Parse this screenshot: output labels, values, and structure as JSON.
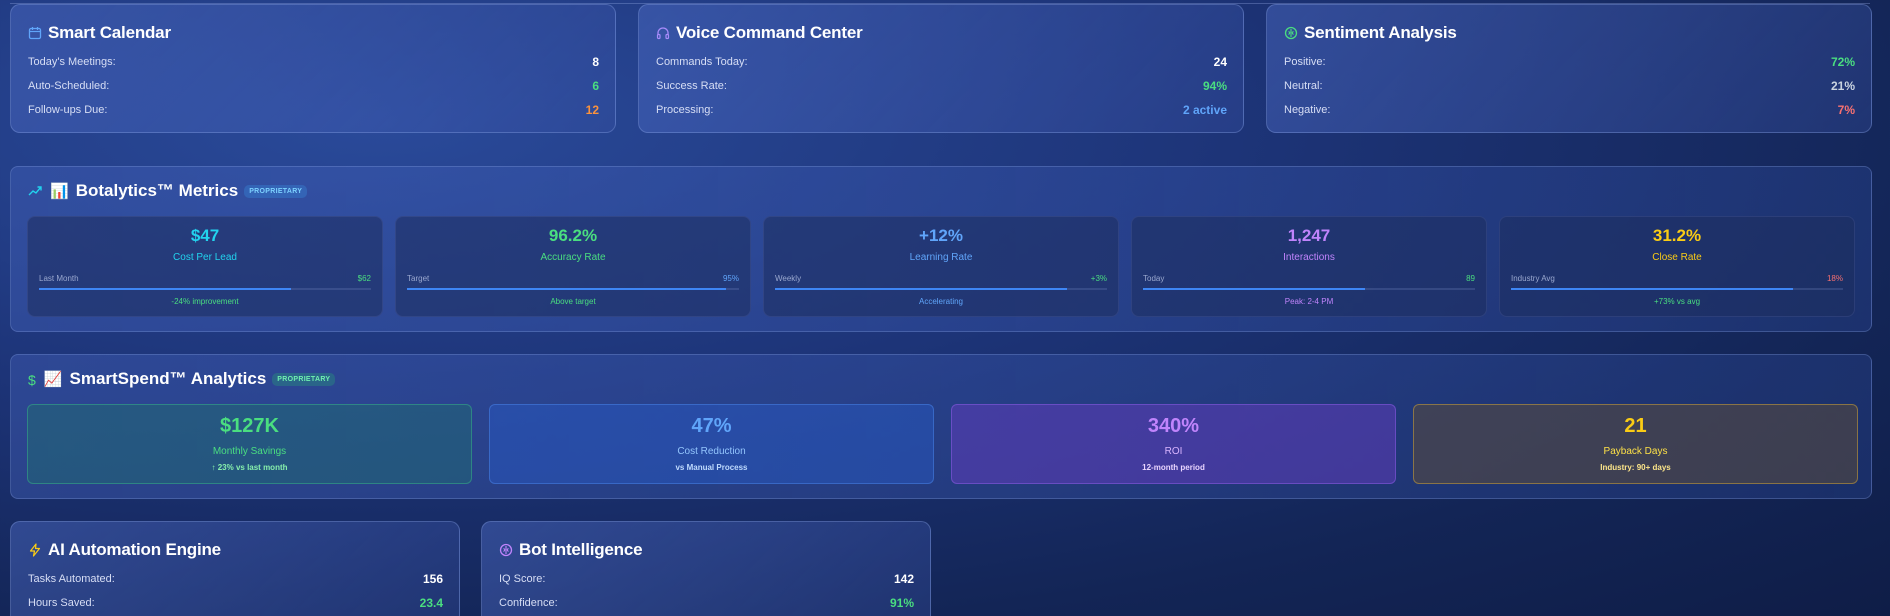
{
  "colors": {
    "green": "#4ade80",
    "orange": "#fb923c",
    "blue": "#60a5fa",
    "red": "#f87171",
    "gray": "#cbd5e1",
    "cyan": "#22d3ee",
    "purple": "#c084fc",
    "yellow": "#facc15",
    "white": "#ffffff"
  },
  "calendar": {
    "title": "Smart Calendar",
    "icon": "calendar-icon",
    "rows": [
      {
        "label": "Today's Meetings:",
        "value": "8"
      },
      {
        "label": "Auto-Scheduled:",
        "value": "6"
      },
      {
        "label": "Follow-ups Due:",
        "value": "12"
      }
    ]
  },
  "voice": {
    "title": "Voice Command Center",
    "icon": "headphones-icon",
    "rows": [
      {
        "label": "Commands Today:",
        "value": "24"
      },
      {
        "label": "Success Rate:",
        "value": "94%"
      },
      {
        "label": "Processing:",
        "value": "2 active"
      }
    ]
  },
  "sentiment": {
    "title": "Sentiment Analysis",
    "icon": "brain-icon",
    "rows": [
      {
        "label": "Positive:",
        "value": "72%"
      },
      {
        "label": "Neutral:",
        "value": "21%"
      },
      {
        "label": "Negative:",
        "value": "7%"
      }
    ]
  },
  "botalytics": {
    "title": "Botalytics™ Metrics",
    "emoji": "📊",
    "icon": "trending-up-icon",
    "badge": "PROPRIETARY",
    "metrics": [
      {
        "value": "$47",
        "name": "Cost Per Lead",
        "sub_label": "Last Month",
        "sub_value": "$62",
        "progress": 0.76,
        "note": "-24% improvement"
      },
      {
        "value": "96.2%",
        "name": "Accuracy Rate",
        "sub_label": "Target",
        "sub_value": "95%",
        "progress": 0.96,
        "note": "Above target"
      },
      {
        "value": "+12%",
        "name": "Learning Rate",
        "sub_label": "Weekly",
        "sub_value": "+3%",
        "progress": 0.88,
        "note": "Accelerating"
      },
      {
        "value": "1,247",
        "name": "Interactions",
        "sub_label": "Today",
        "sub_value": "89",
        "progress": 0.67,
        "note": "Peak: 2-4 PM"
      },
      {
        "value": "31.2%",
        "name": "Close Rate",
        "sub_label": "Industry Avg",
        "sub_value": "18%",
        "progress": 0.85,
        "note": "+73% vs avg"
      }
    ]
  },
  "smartspend": {
    "title": "SmartSpend™ Analytics",
    "emoji": "📈",
    "icon": "dollar-icon",
    "badge": "PROPRIETARY",
    "cards": [
      {
        "value": "$127K",
        "name": "Monthly Savings",
        "note": "↑ 23% vs last month"
      },
      {
        "value": "47%",
        "name": "Cost Reduction",
        "note": "vs Manual Process"
      },
      {
        "value": "340%",
        "name": "ROI",
        "note": "12-month period"
      },
      {
        "value": "21",
        "name": "Payback Days",
        "note": "Industry: 90+ days"
      }
    ]
  },
  "automation": {
    "title": "AI Automation Engine",
    "icon": "lightning-icon",
    "rows": [
      {
        "label": "Tasks Automated:",
        "value": "156"
      },
      {
        "label": "Hours Saved:",
        "value": "23.4"
      }
    ]
  },
  "intelligence": {
    "title": "Bot Intelligence",
    "icon": "brain-icon",
    "rows": [
      {
        "label": "IQ Score:",
        "value": "142"
      },
      {
        "label": "Confidence:",
        "value": "91%"
      }
    ]
  }
}
